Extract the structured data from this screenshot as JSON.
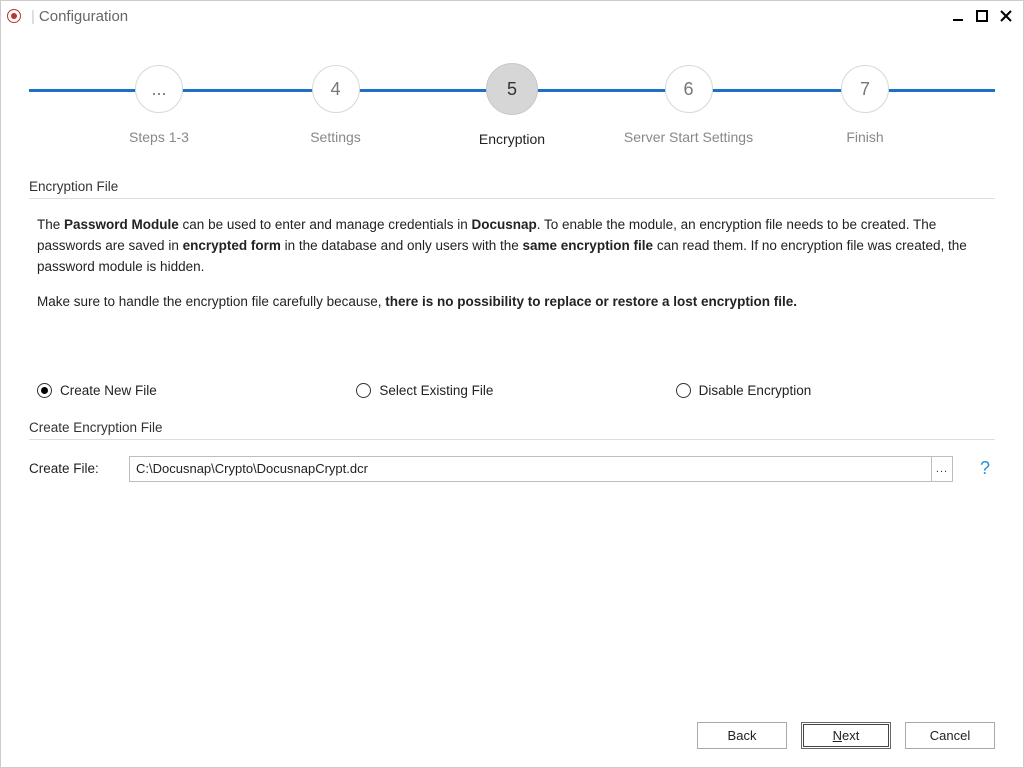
{
  "titlebar": {
    "title": "Configuration"
  },
  "stepper": {
    "steps": [
      {
        "num": "...",
        "label": "Steps 1-3",
        "current": false
      },
      {
        "num": "4",
        "label": "Settings",
        "current": false
      },
      {
        "num": "5",
        "label": "Encryption",
        "current": true
      },
      {
        "num": "6",
        "label": "Server Start Settings",
        "current": false
      },
      {
        "num": "7",
        "label": "Finish",
        "current": false
      }
    ]
  },
  "section1_title": "Encryption File",
  "para1": {
    "t1": "The ",
    "b1": "Password Module",
    "t2": " can be used to enter and manage credentials in ",
    "b2": "Docusnap",
    "t3": ". To enable the module, an encryption file needs to be created. The passwords are saved in ",
    "b3": "encrypted form",
    "t4": " in the database and only users with the ",
    "b4": "same encryption file",
    "t5": " can read them. If no encryption file was created, the password module is hidden."
  },
  "para2": {
    "t1": "Make sure to handle the encryption file carefully because, ",
    "b1": "there is no possibility to replace or restore a lost encryption file."
  },
  "radios": {
    "opt1": "Create New File",
    "opt2": "Select Existing File",
    "opt3": "Disable Encryption",
    "selected": "opt1"
  },
  "section2_title": "Create Encryption File",
  "create_file_label": "Create File:",
  "create_file_value": "C:\\Docusnap\\Crypto\\DocusnapCrypt.dcr",
  "browse_label": "...",
  "help_tooltip": "?",
  "buttons": {
    "back": "Back",
    "next_first": "N",
    "next_rest": "ext",
    "cancel": "Cancel"
  }
}
